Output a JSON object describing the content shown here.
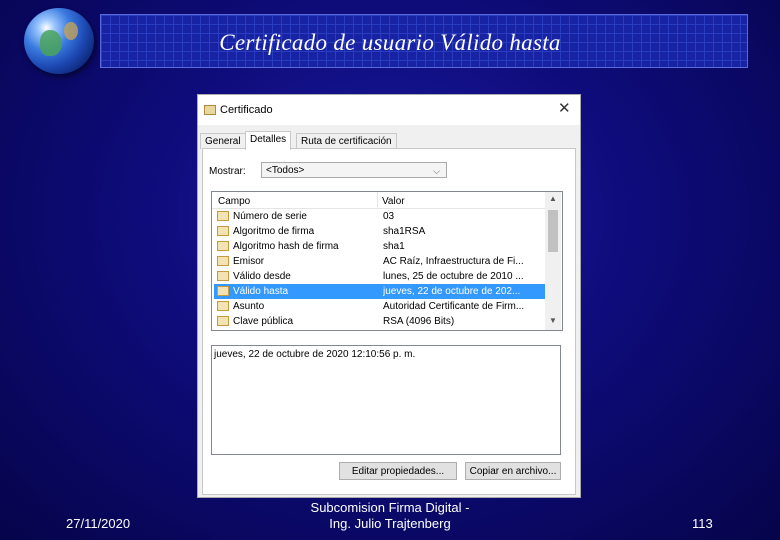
{
  "slide": {
    "title": "Certificado de usuario Válido hasta",
    "footer_date": "27/11/2020",
    "footer_center_line1": "Subcomision Firma Digital -",
    "footer_center_line2": "Ing. Julio Trajtenberg",
    "footer_page": "113"
  },
  "dialog": {
    "title": "Certificado",
    "close_glyph": "✕",
    "tabs": [
      {
        "label": "General"
      },
      {
        "label": "Detalles"
      },
      {
        "label": "Ruta de certificación"
      }
    ],
    "show_label": "Mostrar:",
    "show_value": "<Todos>",
    "columns": {
      "field": "Campo",
      "value": "Valor"
    },
    "rows": [
      {
        "field": "Número de serie",
        "value": "03"
      },
      {
        "field": "Algoritmo de firma",
        "value": "sha1RSA"
      },
      {
        "field": "Algoritmo hash de firma",
        "value": "sha1"
      },
      {
        "field": "Emisor",
        "value": "AC Raíz, Infraestructura de Fi..."
      },
      {
        "field": "Válido desde",
        "value": "lunes, 25 de octubre de 2010 ..."
      },
      {
        "field": "Válido hasta",
        "value": "jueves, 22 de octubre de 202...",
        "selected": true
      },
      {
        "field": "Asunto",
        "value": "Autoridad Certificante de Firm..."
      },
      {
        "field": "Clave pública",
        "value": "RSA (4096 Bits)"
      }
    ],
    "detail_text": "jueves, 22 de octubre de 2020 12:10:56 p. m.",
    "buttons": {
      "edit": "Editar propiedades...",
      "copy": "Copiar en archivo..."
    }
  }
}
